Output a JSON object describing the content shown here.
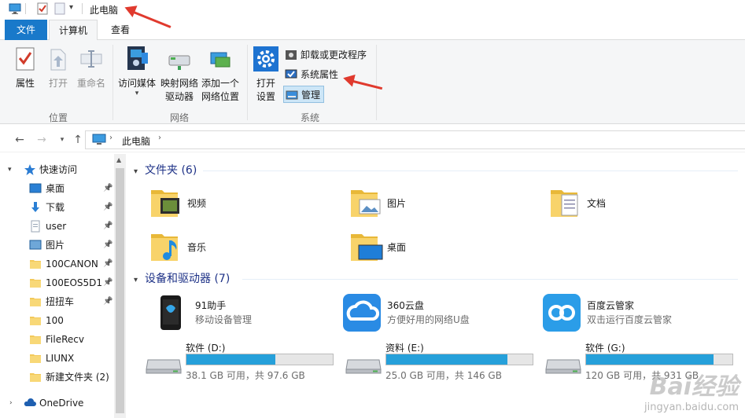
{
  "window": {
    "title": "此电脑"
  },
  "ribbon": {
    "tabs": [
      "文件",
      "计算机",
      "查看"
    ],
    "groups": {
      "location": {
        "label": "位置",
        "buttons": [
          "属性",
          "打开",
          "重命名"
        ]
      },
      "network": {
        "label": "网络",
        "buttons": [
          "访问媒体",
          "映射网络\n驱动器",
          "添加一个\n网络位置"
        ],
        "lines": [
          "访问媒体",
          "映射网络",
          "驱动器",
          "添加一个",
          "网络位置"
        ]
      },
      "system": {
        "label": "系统",
        "open_settings": [
          "打开",
          "设置"
        ],
        "small": [
          "卸载或更改程序",
          "系统属性",
          "管理"
        ]
      }
    }
  },
  "address": {
    "path": "此电脑"
  },
  "navpane": {
    "quick_access": "快速访问",
    "items": [
      {
        "label": "桌面",
        "pinned": true,
        "icon": "desktop-icon"
      },
      {
        "label": "下载",
        "pinned": true,
        "icon": "download-icon"
      },
      {
        "label": "user",
        "pinned": true,
        "icon": "document-icon"
      },
      {
        "label": "图片",
        "pinned": true,
        "icon": "pictures-icon"
      },
      {
        "label": "100CANON",
        "pinned": true,
        "icon": "folder-icon"
      },
      {
        "label": "100EOS5D1",
        "pinned": true,
        "icon": "folder-icon"
      },
      {
        "label": "扭扭车",
        "pinned": true,
        "icon": "folder-icon"
      },
      {
        "label": "100",
        "pinned": false,
        "icon": "folder-icon"
      },
      {
        "label": "FileRecv",
        "pinned": false,
        "icon": "folder-icon"
      },
      {
        "label": "LIUNX",
        "pinned": false,
        "icon": "folder-icon"
      },
      {
        "label": "新建文件夹 (2)",
        "pinned": false,
        "icon": "folder-icon"
      }
    ],
    "onedrive": "OneDrive"
  },
  "content": {
    "folders_header": "文件夹 (6)",
    "folders": [
      {
        "name": "视频",
        "icon": "videos-folder-icon"
      },
      {
        "name": "图片",
        "icon": "pictures-folder-icon"
      },
      {
        "name": "文档",
        "icon": "documents-folder-icon"
      },
      {
        "name": "音乐",
        "icon": "music-folder-icon"
      },
      {
        "name": "桌面",
        "icon": "desktop-folder-icon"
      }
    ],
    "devices_header": "设备和驱动器 (7)",
    "devices": [
      {
        "name": "91助手",
        "desc": "移动设备管理",
        "color": "#1a1a1a"
      },
      {
        "name": "360云盘",
        "desc": "方便好用的网络U盘",
        "color": "#2a8be4"
      },
      {
        "name": "百度云管家",
        "desc": "双击运行百度云管家",
        "color": "#2b9de8"
      }
    ],
    "drives": [
      {
        "name": "软件 (D:)",
        "free": "38.1 GB 可用，共 97.6 GB",
        "used_fraction": 0.61
      },
      {
        "name": "资料 (E:)",
        "free": "25.0 GB 可用，共 146 GB",
        "used_fraction": 0.83
      },
      {
        "name": "软件 (G:)",
        "free": "120 GB 可用，共 931 GB",
        "used_fraction": 0.87
      }
    ]
  },
  "watermark": {
    "brand": "Bai",
    "brand2": "经验",
    "url": "jingyan.baidu.com"
  },
  "colors": {
    "accent": "#1979ca",
    "drive_fill": "#26a0da",
    "annotation": "#e03a2e"
  }
}
